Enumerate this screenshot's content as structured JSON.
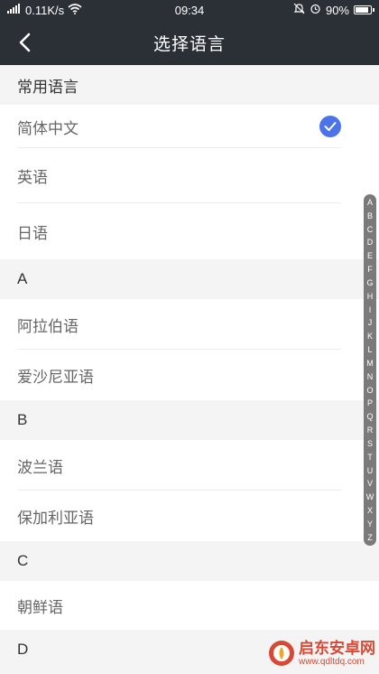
{
  "status_bar": {
    "network_speed": "0.11K/s",
    "time": "09:34",
    "battery": "90%",
    "battery_level": 0.9
  },
  "nav": {
    "title": "选择语言"
  },
  "sections": [
    {
      "header": "常用语言",
      "items": [
        {
          "label": "简体中文",
          "selected": true
        },
        {
          "label": "英语"
        },
        {
          "label": "日语"
        }
      ]
    },
    {
      "header": "A",
      "items": [
        {
          "label": "阿拉伯语"
        },
        {
          "label": "爱沙尼亚语"
        }
      ]
    },
    {
      "header": "B",
      "items": [
        {
          "label": "波兰语"
        },
        {
          "label": "保加利亚语"
        }
      ]
    },
    {
      "header": "C",
      "items": [
        {
          "label": "朝鲜语"
        }
      ]
    },
    {
      "header": "D",
      "items": []
    }
  ],
  "index_letters": [
    "A",
    "B",
    "C",
    "D",
    "E",
    "F",
    "G",
    "H",
    "I",
    "J",
    "K",
    "L",
    "M",
    "N",
    "O",
    "P",
    "Q",
    "R",
    "S",
    "T",
    "U",
    "V",
    "W",
    "X",
    "Y",
    "Z"
  ],
  "watermark": {
    "title": "启东安卓网",
    "url": "www.qdltdq.com"
  },
  "colors": {
    "nav_bg": "#2b2f36",
    "accent": "#4a74e8",
    "watermark": "#d6402b"
  }
}
